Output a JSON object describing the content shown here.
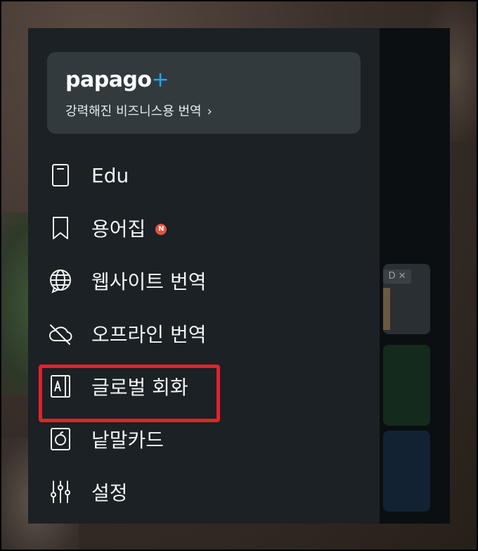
{
  "promo": {
    "logo_text": "papago",
    "logo_plus": "+",
    "subtitle": "강력해진 비즈니스용 번역",
    "chevron": "›"
  },
  "menu": {
    "items": [
      {
        "label": "Edu",
        "icon": "tablet-icon"
      },
      {
        "label": "용어집",
        "icon": "bookmark-icon",
        "badge": "N"
      },
      {
        "label": "웹사이트 번역",
        "icon": "globe-icon"
      },
      {
        "label": "오프라인 번역",
        "icon": "cloud-off-icon"
      },
      {
        "label": "글로벌 회화",
        "icon": "conversation-book-icon"
      },
      {
        "label": "낱말카드",
        "icon": "word-card-icon"
      },
      {
        "label": "설정",
        "icon": "sliders-icon"
      }
    ]
  },
  "right_pane": {
    "ad_label": "D ✕"
  },
  "colors": {
    "highlight": "#e5202e",
    "badge": "#e1533e",
    "logo_plus": "#1ea7ff",
    "drawer_bg": "#1b2124"
  }
}
